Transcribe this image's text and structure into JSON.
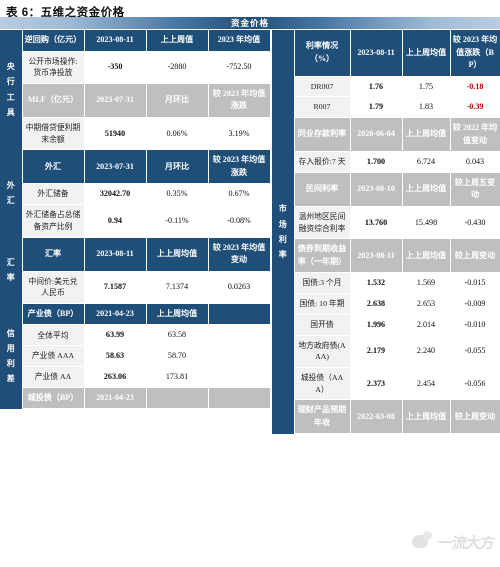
{
  "caption": "表 6：五维之资金价格",
  "band_title": "资金价格",
  "colors": {
    "header_blue": "#1f4e79",
    "header_grey": "#bfbfbf",
    "label_grey": "#f2f2f2",
    "negative_red": "#c00000"
  },
  "watermark": {
    "text": "一流大方"
  },
  "left_table": {
    "sections": [
      {
        "side_label": "央行工具",
        "blocks": [
          {
            "header_style": "blue",
            "headers": [
              "逆回购（亿元）",
              "2023-08-11",
              "上上周值",
              "2023 年均值"
            ],
            "rows": [
              {
                "label": "公开市场操作:货币净投放",
                "values": [
                  "-350",
                  "-2880",
                  "-752.50"
                ]
              }
            ]
          },
          {
            "header_style": "grey",
            "headers": [
              "MLF（亿元）",
              "2023-07-31",
              "月环比",
              "较 2023 年均值涨跌"
            ],
            "rows": [
              {
                "label": "中期借贷便利期末余额",
                "values": [
                  "51940",
                  "0.06%",
                  "3.19%"
                ]
              }
            ]
          }
        ]
      },
      {
        "side_label": "外汇",
        "blocks": [
          {
            "header_style": "blue",
            "headers": [
              "外汇",
              "2023-07-31",
              "月环比",
              "较 2023 年均值涨跌"
            ],
            "rows": [
              {
                "label": "外汇储备",
                "values": [
                  "32042.70",
                  "0.35%",
                  "0.67%"
                ]
              },
              {
                "label": "外汇储备占总储备资产比例",
                "values": [
                  "0.94",
                  "-0.11%",
                  "-0.08%"
                ]
              }
            ]
          }
        ]
      },
      {
        "side_label": "汇率",
        "blocks": [
          {
            "header_style": "blue",
            "headers": [
              "汇率",
              "2023-08-11",
              "上上周均值",
              "较 2023 年均值变动"
            ],
            "rows": [
              {
                "label": "中间价:美元兑人民币",
                "values": [
                  "7.1587",
                  "7.1374",
                  "0.0263"
                ]
              }
            ]
          }
        ]
      },
      {
        "side_label": "信用利差",
        "blocks": [
          {
            "header_style": "blue",
            "headers": [
              "产业债（BP）",
              "2021-04-23",
              "上上周均值",
              ""
            ],
            "rows": [
              {
                "label": "全体平均",
                "values": [
                  "63.99",
                  "63.58",
                  ""
                ]
              },
              {
                "label": "产业债 AAA",
                "values": [
                  "58.63",
                  "58.70",
                  ""
                ]
              },
              {
                "label": "产业债 AA",
                "values": [
                  "263.06",
                  "173.81",
                  ""
                ]
              }
            ]
          },
          {
            "header_style": "grey",
            "headers": [
              "城投债（BP）",
              "2021-04-23",
              "",
              ""
            ],
            "rows": []
          }
        ]
      }
    ]
  },
  "right_table": {
    "sections": [
      {
        "side_label": "市场利率",
        "blocks": [
          {
            "header_style": "blue",
            "headers": [
              "利率情况（%）",
              "2023-08-11",
              "上上周均值",
              "较 2023 年均值涨跌（BP）"
            ],
            "rows": [
              {
                "label": "DR007",
                "values": [
                  "1.76",
                  "1.75",
                  "-0.18"
                ],
                "value_styles": [
                  "bold",
                  "plain",
                  "neg"
                ]
              },
              {
                "label": "R007",
                "values": [
                  "1.79",
                  "1.83",
                  "-0.39"
                ],
                "value_styles": [
                  "bold",
                  "plain",
                  "neg"
                ]
              }
            ]
          },
          {
            "header_style": "grey",
            "headers": [
              "同业存款利率",
              "2020-06-04",
              "上上周均值",
              "较 2022 年均值变动"
            ],
            "rows": [
              {
                "label": "存入报价:7 天",
                "values": [
                  "1.700",
                  "6.724",
                  "0.043"
                ],
                "value_styles": [
                  "bold",
                  "plain",
                  "plain"
                ]
              }
            ]
          },
          {
            "header_style": "grey",
            "headers": [
              "民间利率",
              "2023-08-10",
              "上上周均值",
              "较上周五变动"
            ],
            "rows": [
              {
                "label": "温州地区民间融资综合利率",
                "values": [
                  "13.760",
                  "15.498",
                  "-0.430"
                ],
                "value_styles": [
                  "bold",
                  "plain",
                  "plain"
                ]
              }
            ]
          },
          {
            "header_style": "grey",
            "headers": [
              "债券到期收益率（一年期）",
              "2023-08-11",
              "上上周均值",
              "较上周变动"
            ],
            "rows": [
              {
                "label": "国债:3 个月",
                "values": [
                  "1.532",
                  "1.569",
                  "-0.015"
                ],
                "value_styles": [
                  "bold",
                  "plain",
                  "plain"
                ]
              },
              {
                "label": "国债: 10 年期",
                "values": [
                  "2.638",
                  "2.653",
                  "-0.009"
                ],
                "value_styles": [
                  "bold",
                  "plain",
                  "plain"
                ]
              },
              {
                "label": "国开债",
                "values": [
                  "1.996",
                  "2.014",
                  "-0.010"
                ],
                "value_styles": [
                  "bold",
                  "plain",
                  "plain"
                ]
              },
              {
                "label": "地方政府债(AAA)",
                "values": [
                  "2.179",
                  "2.240",
                  "-0.055"
                ],
                "value_styles": [
                  "bold",
                  "plain",
                  "plain"
                ]
              },
              {
                "label": "城投债（AAA）",
                "values": [
                  "2.373",
                  "2.454",
                  "-0.056"
                ],
                "value_styles": [
                  "bold",
                  "plain",
                  "plain"
                ]
              }
            ]
          },
          {
            "header_style": "grey",
            "headers": [
              "理财产品预期年收",
              "2022-03-08",
              "上上周均值",
              "较上周变动"
            ],
            "rows": []
          }
        ]
      }
    ]
  }
}
